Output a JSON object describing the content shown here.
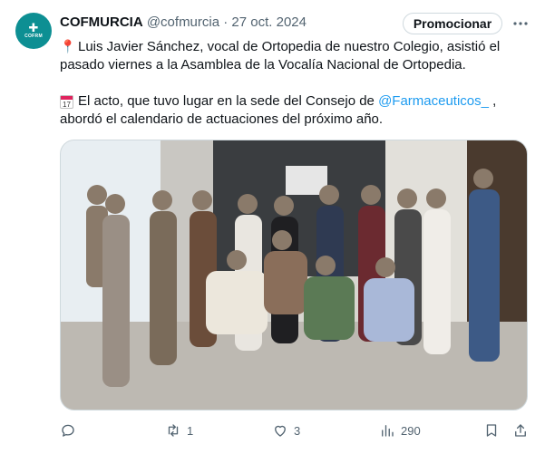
{
  "author": {
    "name": "COFMURCIA",
    "handle": "@cofmurcia",
    "separator": "·",
    "date": "27 oct. 2024",
    "avatar_text": "COFRM"
  },
  "promote_label": "Promocionar",
  "more_icon": "more-dots-icon",
  "text": {
    "line1": "Luis Javier Sánchez, vocal de Ortopedia de nuestro Colegio, asistió el pasado viernes a la Asamblea de la Vocalía Nacional de Ortopedia.",
    "line2_pre": "El acto, que tuvo lugar en la sede del Consejo de ",
    "mention": "@Farmaceuticos_",
    "line2_post": " , abordó el calendario de actuaciones del próximo año.",
    "calendar_day": "17"
  },
  "photo": {
    "description_icon": "group-photo-image"
  },
  "actions": {
    "reply_count": "",
    "retweet_count": "1",
    "like_count": "3",
    "views_count": "290"
  },
  "colors": {
    "link": "#1d9bf0",
    "muted": "#536471",
    "avatar": "#0d8f93"
  }
}
